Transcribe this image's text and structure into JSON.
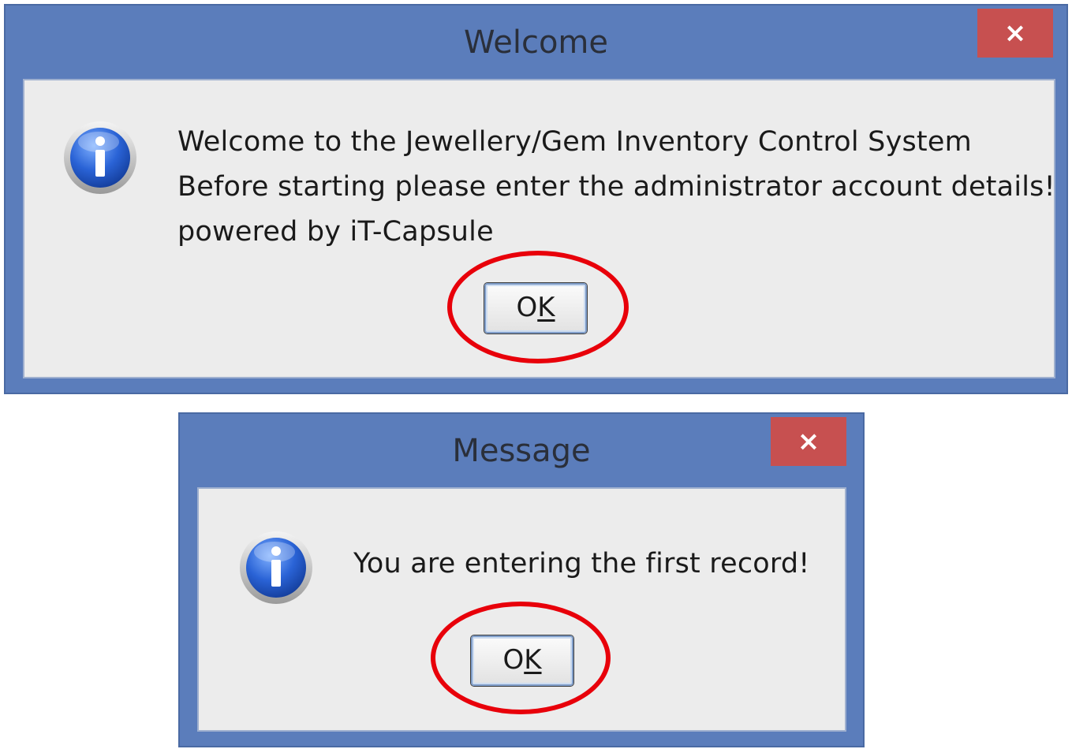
{
  "dialogs": [
    {
      "title": "Welcome",
      "close_label": "×",
      "icon": "info-icon",
      "message_lines": [
        "Welcome to the Jewellery/Gem Inventory Control System",
        "Before starting please enter the administrator account details!",
        "powered by iT-Capsule"
      ],
      "ok_label_prefix": "O",
      "ok_label_mnemonic": "K"
    },
    {
      "title": "Message",
      "close_label": "×",
      "icon": "info-icon",
      "message_lines": [
        "You are entering the first record!"
      ],
      "ok_label_prefix": "O",
      "ok_label_mnemonic": "K"
    }
  ],
  "colors": {
    "title_bar": "#5b7dbb",
    "close_button": "#c75050",
    "dialog_body": "#ececec",
    "highlight": "#e8000a"
  }
}
